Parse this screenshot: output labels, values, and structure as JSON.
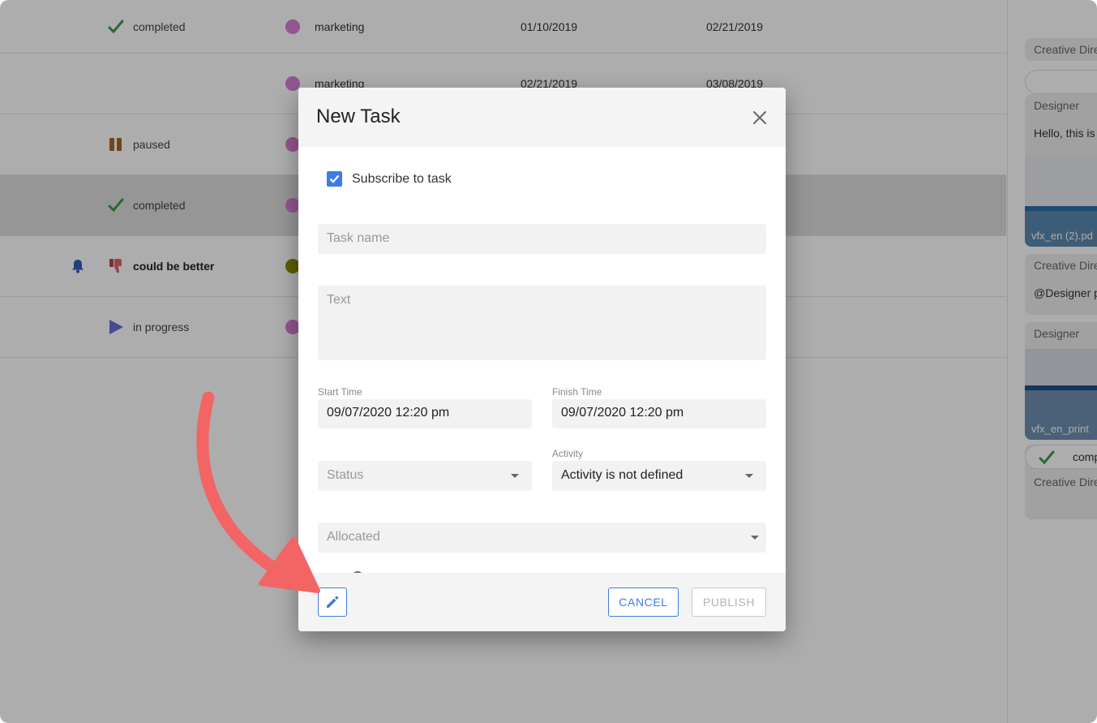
{
  "tasks": [
    {
      "status": "completed",
      "status_icon": "check-icon",
      "activity": "marketing",
      "activity_color": "#d77fd6",
      "start": "01/10/2019",
      "finish": "02/21/2019"
    },
    {
      "status": "",
      "status_icon": "",
      "activity": "marketing",
      "activity_color": "#d77fd6",
      "start": "02/21/2019",
      "finish": "03/08/2019"
    },
    {
      "status": "paused",
      "status_icon": "pause-icon",
      "activity": "",
      "activity_color": "#d77fd6",
      "start": "",
      "finish": ""
    },
    {
      "status": "completed",
      "status_icon": "check-icon",
      "activity": "",
      "activity_color": "#d77fd6",
      "start": "",
      "finish": ""
    },
    {
      "status": "could be better",
      "status_icon": "thumbs-down-icon",
      "activity": "",
      "activity_color": "#8a8a00",
      "start": "",
      "finish": ""
    },
    {
      "status": "in progress",
      "status_icon": "play-icon",
      "activity": "",
      "activity_color": "#d77fd6",
      "start": "",
      "finish": ""
    }
  ],
  "right_panel": {
    "card1_label": "Creative Dire",
    "card2_label": "Designer",
    "card2_text": "Hello, this is",
    "card2_file": "vfx_en (2).pd",
    "card3_label": "Creative Dire",
    "card3_text": "@Designer p",
    "card4_label": "Designer",
    "card4_file": "vfx_en_print",
    "card5_status": "comp",
    "card5_label": "Creative Dire"
  },
  "modal": {
    "title": "New Task",
    "subscribe_label": "Subscribe to task",
    "subscribe_checked": true,
    "task_name_placeholder": "Task name",
    "text_placeholder": "Text",
    "start_time_label": "Start Time",
    "start_time_value": "09/07/2020 12:20 pm",
    "finish_time_label": "Finish Time",
    "finish_time_value": "09/07/2020 12:20 pm",
    "status_placeholder": "Status",
    "activity_label": "Activity",
    "activity_value": "Activity is not defined",
    "allocated_placeholder": "Allocated",
    "cancel_label": "CANCEL",
    "publish_label": "PUBLISH"
  },
  "colors": {
    "accent": "#3e7be6",
    "arrow": "#f36464",
    "check": "#3a9b4a"
  }
}
